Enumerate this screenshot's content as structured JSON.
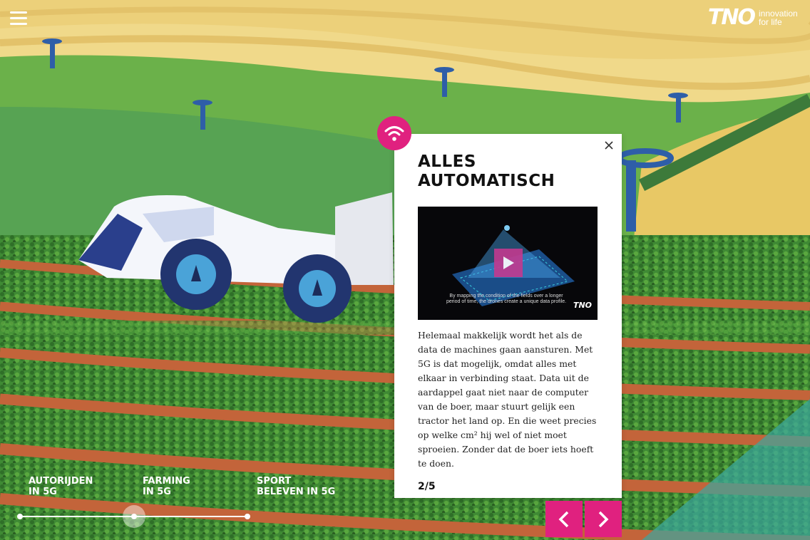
{
  "header": {
    "menu_icon": "hamburger-menu-icon",
    "logo": {
      "mark": "TNO",
      "tagline": "innovation for life"
    }
  },
  "card": {
    "icon": "wifi-signal-icon",
    "title_line1": "ALLES",
    "title_line2": "AUTOMATISCH",
    "video": {
      "caption": "By mapping the condition of the fields over a longer period of time, the drones create a unique data profile.",
      "logo": "TNO",
      "play_icon": "play-icon"
    },
    "body": "Helemaal makkelijk wordt het als de data de machines gaan aansturen. Met 5G is dat mogelijk, omdat alles met elkaar in verbinding staat. Data uit de aardappel gaat niet naar de computer van de boer, maar stuurt gelijk een tractor het land op. En die weet precies op welke cm² hij wel of niet moet sproeien. Zonder dat de boer iets hoeft te doen.",
    "pager": "2/5",
    "close_icon": "close-icon"
  },
  "navigation": {
    "prev_icon": "chevron-left-icon",
    "next_icon": "chevron-right-icon"
  },
  "timeline": {
    "items": [
      {
        "line1": "AUTORIJDEN",
        "line2": "IN 5G"
      },
      {
        "line1": "FARMING",
        "line2": "IN 5G"
      },
      {
        "line1": "SPORT",
        "line2": "BELEVEN IN 5G"
      }
    ],
    "active_index": 1
  },
  "colors": {
    "accent": "#e0217f",
    "sky": "#f2dc86",
    "field_green": "#4f9a3a",
    "soil": "#c0643a",
    "machine_blue": "#2a3f8c"
  }
}
